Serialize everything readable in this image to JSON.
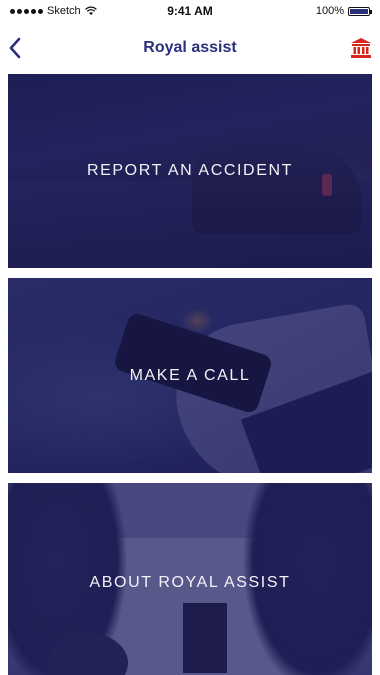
{
  "status_bar": {
    "carrier": "Sketch",
    "time": "9:41 AM",
    "battery_percent": "100%",
    "battery_level": 1.0
  },
  "nav": {
    "title": "Royal assist",
    "back_icon": "chevron-left-icon",
    "action_icon": "bank-icon",
    "title_color": "#2c2f7c",
    "action_color": "#d7261e"
  },
  "tiles": [
    {
      "label": "REPORT AN ACCIDENT"
    },
    {
      "label": "MAKE A CALL"
    },
    {
      "label": "ABOUT ROYAL ASSIST"
    }
  ],
  "colors": {
    "overlay": "#1e1c5c",
    "accent": "#2c2f7c"
  }
}
